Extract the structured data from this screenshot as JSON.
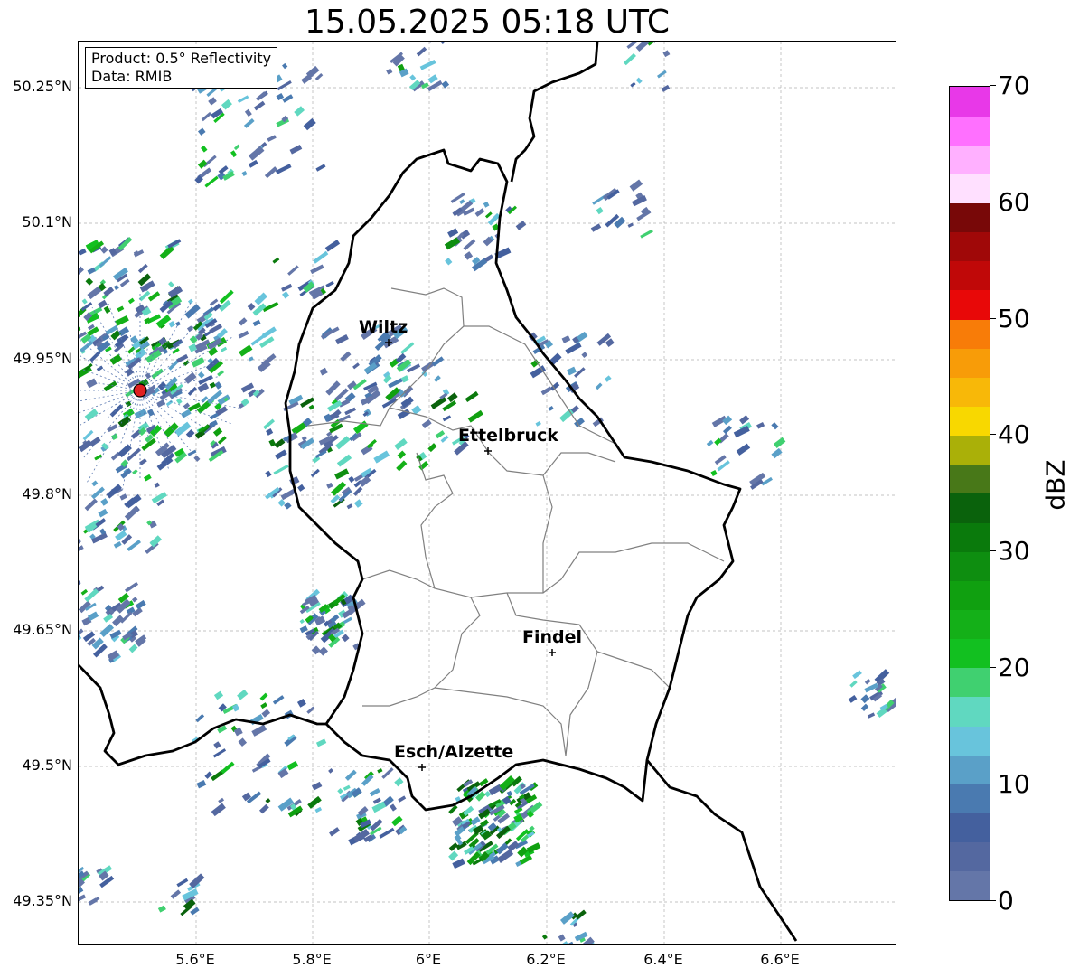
{
  "title": "15.05.2025 05:18 UTC",
  "info": {
    "product": "Product: 0.5° Reflectivity",
    "data": "Data: RMIB"
  },
  "axes": {
    "lat_ticks": [
      "50.25°N",
      "50.1°N",
      "49.95°N",
      "49.8°N",
      "49.65°N",
      "49.5°N",
      "49.35°N"
    ],
    "lon_ticks": [
      "5.6°E",
      "5.8°E",
      "6°E",
      "6.2°E",
      "6.4°E",
      "6.6°E"
    ]
  },
  "cities": [
    {
      "name": "Wiltz"
    },
    {
      "name": "Ettelbruck"
    },
    {
      "name": "Findel"
    },
    {
      "name": "Esch/Alzette"
    }
  ],
  "colorbar": {
    "label": "dBZ",
    "ticks": [
      "0",
      "10",
      "20",
      "30",
      "40",
      "50",
      "60",
      "70"
    ],
    "colors": [
      "#6476a8",
      "#5468a0",
      "#44609e",
      "#4a7ab0",
      "#5aa0c8",
      "#68c4dc",
      "#60d8c0",
      "#40d070",
      "#12c020",
      "#14b018",
      "#10a010",
      "#0e8e10",
      "#0a7a0c",
      "#0a620c",
      "#487818",
      "#aab008",
      "#f8d800",
      "#f8b808",
      "#f89c08",
      "#f87c08",
      "#e80808",
      "#c00808",
      "#a00808",
      "#780808",
      "#ffe0ff",
      "#ffb0ff",
      "#ff70ff",
      "#e838e8"
    ],
    "range": [
      0,
      70
    ]
  },
  "map": {
    "lon_range": [
      5.4,
      6.8
    ],
    "lat_range": [
      49.3,
      50.3
    ],
    "grid": true,
    "radar_site_marker": "red-circle"
  },
  "colors": {
    "border": "#000000",
    "district_lines": "#808080",
    "grid": "#b0b0b0"
  }
}
